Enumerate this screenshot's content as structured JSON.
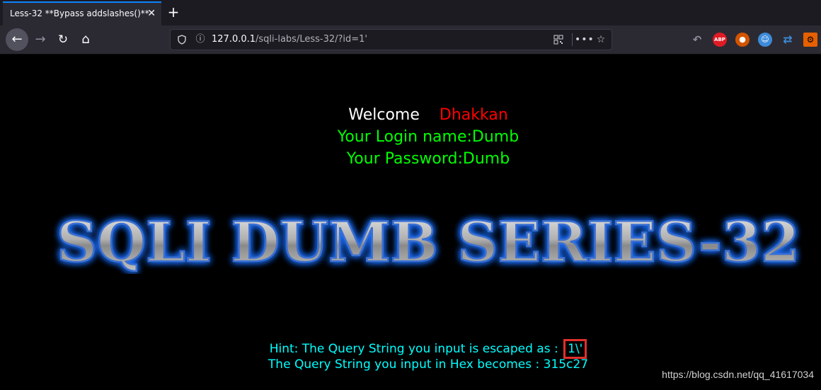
{
  "browser": {
    "tab_title": "Less-32 **Bypass addslashes()**",
    "tab_close": "✕",
    "new_tab": "+",
    "url_host": "127.0.0.1",
    "url_path": "/sqli-labs/Less-32/?id=1'"
  },
  "page": {
    "welcome": "Welcome",
    "welcome_name": "Dhakkan",
    "login_name": "Your Login name:Dumb",
    "password": "Your Password:Dumb",
    "banner_title": "SQLI DUMB SERIES-32",
    "hint_escaped_prefix": "Hint: The Query String you input is escaped as : ",
    "hint_escaped_value": "1\\'",
    "hint_hex": "The Query String you input in Hex becomes : 315c27",
    "watermark": "https://blog.csdn.net/qq_41617034"
  },
  "colors": {
    "welcome": "#ffffff",
    "name": "#ff0000",
    "credentials": "#00ff00",
    "hint": "#00ffff",
    "banner_glow": "#1e6fff",
    "highlight_box": "#e0302d"
  },
  "icons": [
    "back-arrow-icon",
    "forward-arrow-icon",
    "reload-icon",
    "home-icon",
    "shield-icon",
    "info-icon",
    "qr-code-icon",
    "more-icon",
    "star-icon",
    "undo-icon",
    "adblock-icon",
    "firefox-icon",
    "face-icon",
    "sync-icon",
    "hackbar-icon"
  ]
}
